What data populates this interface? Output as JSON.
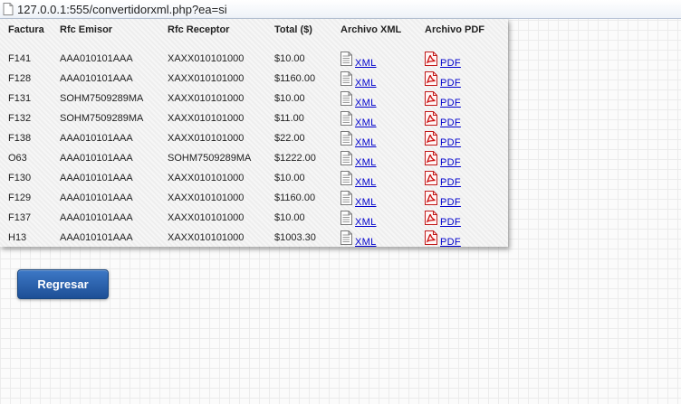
{
  "browser": {
    "url": "127.0.0.1:555/convertidorxml.php?ea=si"
  },
  "table": {
    "columns": [
      "Factura",
      "Rfc Emisor",
      "Rfc Receptor",
      "Total ($)",
      "Archivo XML",
      "Archivo PDF"
    ],
    "link_labels": {
      "xml": "XML",
      "pdf": "PDF"
    },
    "rows": [
      [
        "F141",
        "AAA010101AAA",
        "XAXX010101000",
        "$10.00"
      ],
      [
        "F128",
        "AAA010101AAA",
        "XAXX010101000",
        "$1160.00"
      ],
      [
        "F131",
        "SOHM7509289MA",
        "XAXX010101000",
        "$10.00"
      ],
      [
        "F132",
        "SOHM7509289MA",
        "XAXX010101000",
        "$11.00"
      ],
      [
        "F138",
        "AAA010101AAA",
        "XAXX010101000",
        "$22.00"
      ],
      [
        "O63",
        "AAA010101AAA",
        "SOHM7509289MA",
        "$1222.00"
      ],
      [
        "F130",
        "AAA010101AAA",
        "XAXX010101000",
        "$10.00"
      ],
      [
        "F129",
        "AAA010101AAA",
        "XAXX010101000",
        "$1160.00"
      ],
      [
        "F137",
        "AAA010101AAA",
        "XAXX010101000",
        "$10.00"
      ],
      [
        "H13",
        "AAA010101AAA",
        "XAXX010101000",
        "$1003.30"
      ]
    ]
  },
  "actions": {
    "back_label": "Regresar"
  },
  "colors": {
    "link": "#0000cc",
    "button": "#2a5fa8",
    "pdf_icon": "#cc1111"
  },
  "icons": {
    "xml": "document-icon",
    "pdf": "pdf-icon",
    "page": "page-icon"
  }
}
